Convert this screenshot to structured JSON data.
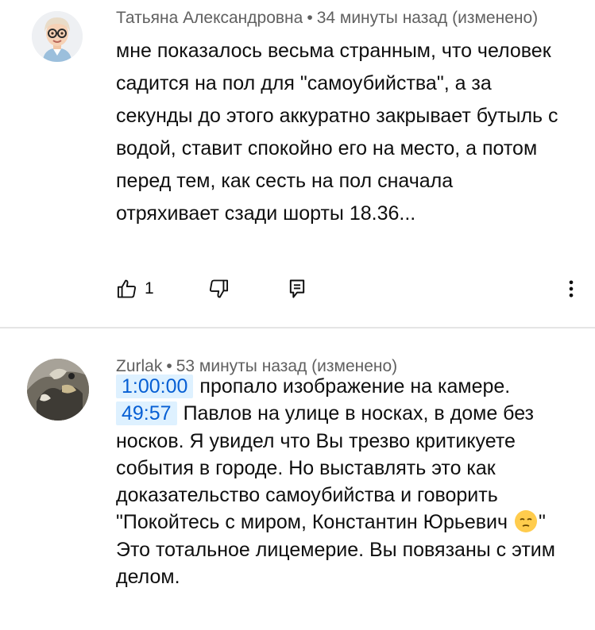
{
  "comments": [
    {
      "author": "Татьяна Александровна",
      "time": "34 минуты назад (изменено)",
      "avatar_icon": "memoji-avatar",
      "text": "мне показалось весьма странным, что человек садится на пол для \"самоубийства\", а за секунды до этого аккуратно закрывает бутыль с водой, ставит спокойно его на место, а потом перед тем, как сесть на пол сначала отряхивает сзади шорты 18.36...",
      "likes": "1",
      "icons": {
        "like": "thumb-up-icon",
        "dislike": "thumb-down-icon",
        "reply": "reply-icon",
        "more": "more-vert-icon"
      }
    },
    {
      "author": "Zurlak",
      "time": "53 минуты назад (изменено)",
      "avatar_icon": "photo-avatar",
      "parts": {
        "ts1": "1:00:00",
        "t1": "пропало изображение на камере.",
        "ts2": "49:57",
        "t2": "Павлов на улице в носках, в доме без носков. Я увидел что Вы трезво критикуете  события в  городе. Но выставлять это как доказательство самоубийства и говорить \"Покойтесь с миром, Константин Юрьевич",
        "emoji": "pensive-face-emoji",
        "t3": "\" Это тотальное лицемерие. Вы повязаны с этим делом."
      }
    }
  ],
  "colors": {
    "timestamp_bg": "#def1ff",
    "timestamp_text": "#065fd4",
    "meta": "#606060",
    "divider": "#e5e5e5"
  }
}
